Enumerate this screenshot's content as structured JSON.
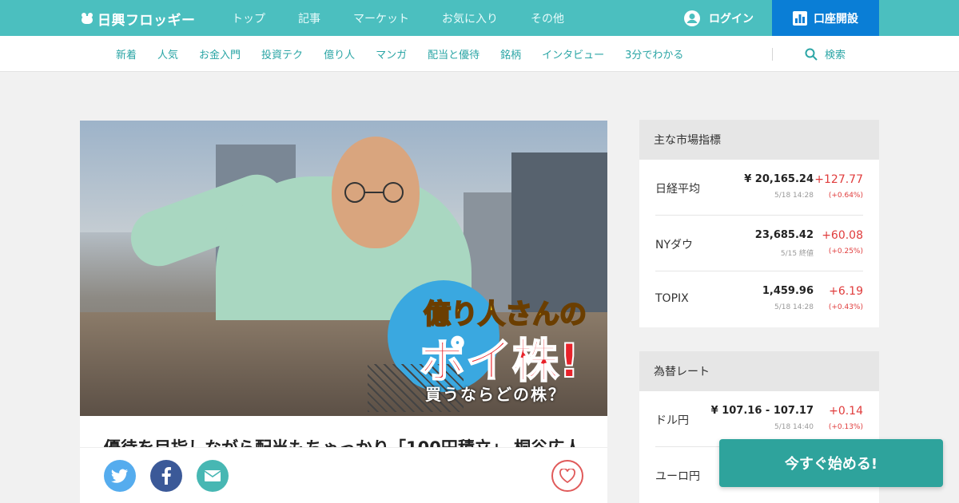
{
  "header": {
    "logo_text": "日興フロッギー",
    "nav": [
      "トップ",
      "記事",
      "マーケット",
      "お気に入り",
      "その他"
    ],
    "login_label": "ログイン",
    "open_account_label": "口座開設",
    "brand_color": "#4bbfbf",
    "accent_color": "#0a7ed6"
  },
  "subnav": {
    "items": [
      "新着",
      "人気",
      "お金入門",
      "投資テク",
      "億り人",
      "マンガ",
      "配当と優待",
      "銘柄",
      "インタビュー",
      "3分でわかる"
    ],
    "search_label": "検索"
  },
  "hero": {
    "title_line1": "億り人さんの",
    "title_line2": "ポイ株!",
    "title_line3": "買うならどの株？"
  },
  "article": {
    "title": "優待を目指しながら配当もちゃっかり「100円積立」 桐谷広人"
  },
  "share": {
    "icons": [
      "twitter-icon",
      "facebook-icon",
      "mail-icon",
      "heart-icon"
    ]
  },
  "market": {
    "heading": "主な市場指標",
    "rows": [
      {
        "name": "日経平均",
        "value": "¥ 20,165.24",
        "change": "+127.77",
        "time": "5/18 14:28",
        "pct": "(+0.64%)"
      },
      {
        "name": "NYダウ",
        "value": "23,685.42",
        "change": "+60.08",
        "time": "5/15 終値",
        "pct": "(+0.25%)"
      },
      {
        "name": "TOPIX",
        "value": "1,459.96",
        "change": "+6.19",
        "time": "5/18 14:28",
        "pct": "(+0.43%)"
      }
    ]
  },
  "fx": {
    "heading": "為替レート",
    "rows": [
      {
        "name": "ドル円",
        "value": "¥ 107.16 - 107.17",
        "change": "+0.14",
        "time": "5/18 14:40",
        "pct": "(+0.13%)"
      },
      {
        "name": "ユーロ円",
        "value": "",
        "change": "",
        "time": "",
        "pct": ""
      }
    ]
  },
  "cta_label": "今すぐ始める!",
  "cta_color": "#2ea39c",
  "up_color": "#e03c3c"
}
